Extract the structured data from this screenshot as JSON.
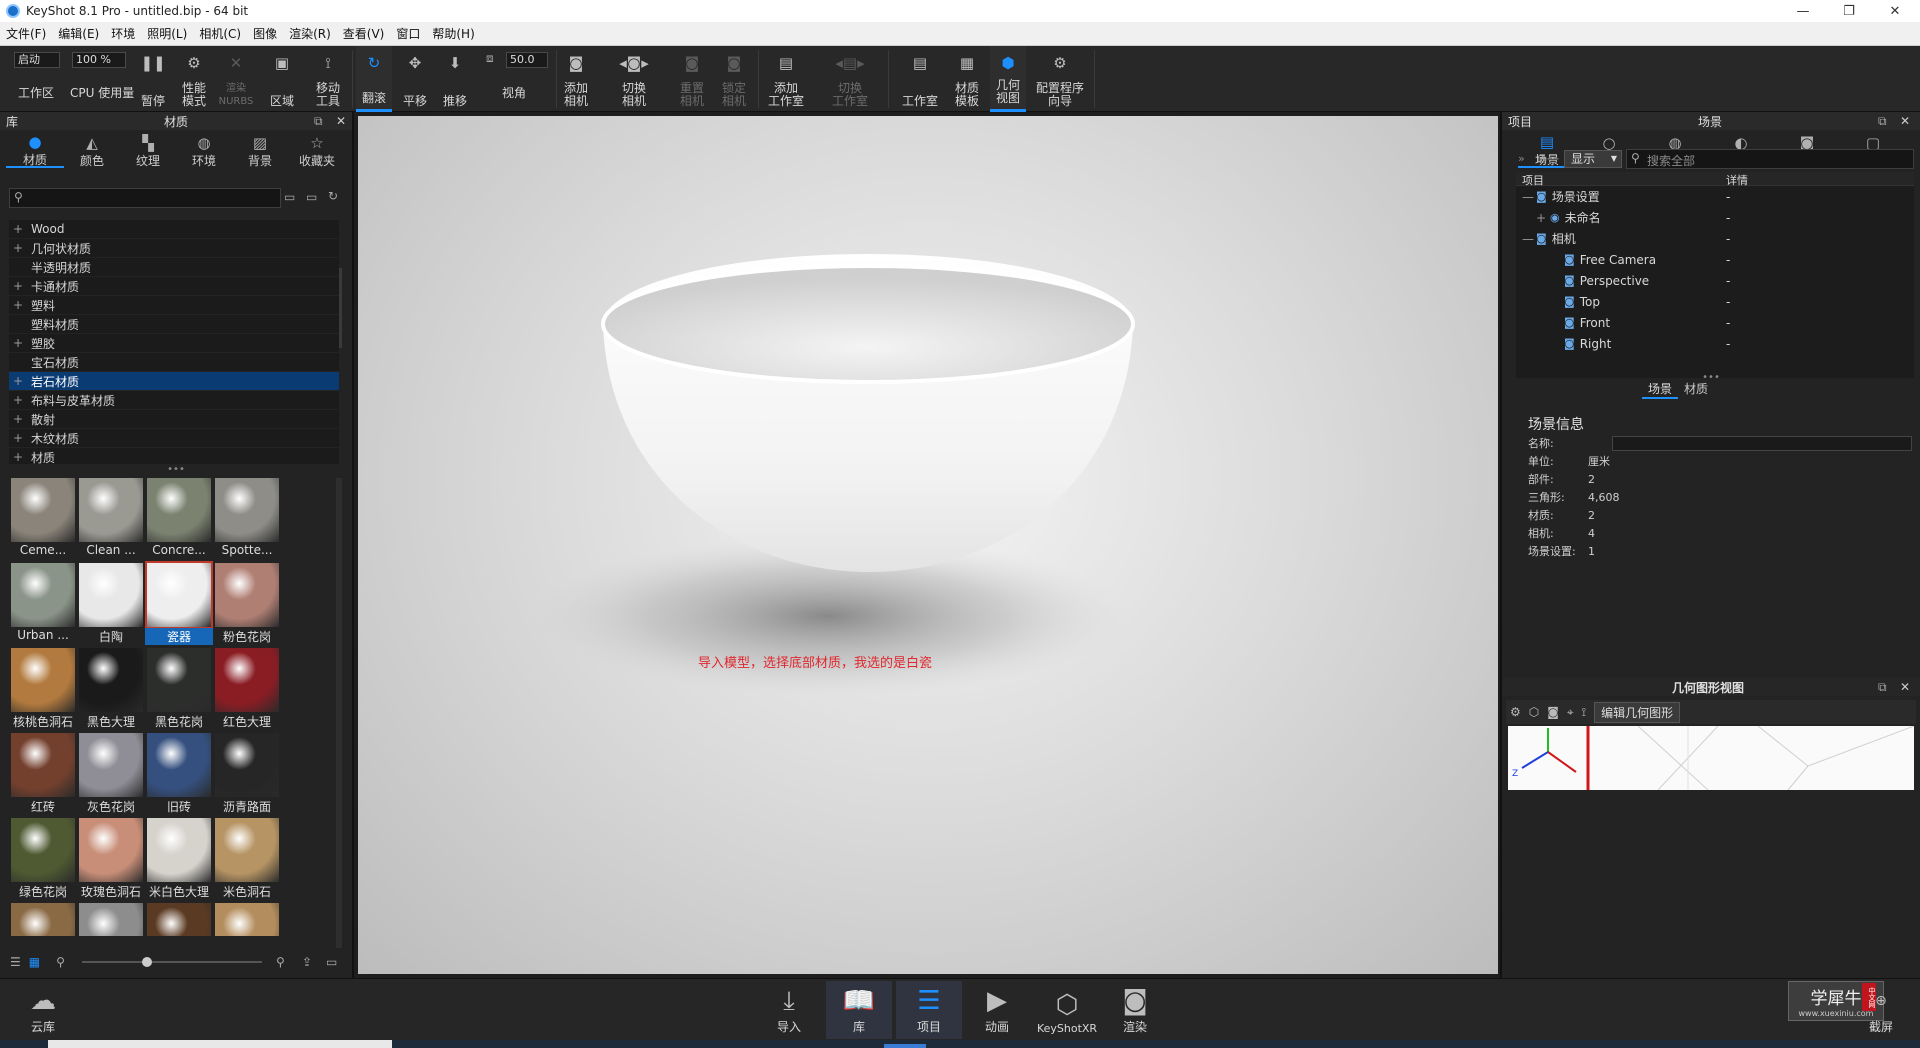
{
  "window": {
    "title": "KeyShot 8.1 Pro  - untitled.bip  - 64 bit",
    "minimize": "—",
    "maximize": "❐",
    "close": "✕"
  },
  "menu": [
    "文件(F)",
    "编辑(E)",
    "环境",
    "照明(L)",
    "相机(C)",
    "图像",
    "渲染(R)",
    "查看(V)",
    "窗口",
    "帮助(H)"
  ],
  "toolbar": {
    "start_value": "启动",
    "percent_value": "100 %",
    "fov_value": "50.0",
    "workspace": "工作区",
    "cpu": "CPU 使用量",
    "pause": "暂停",
    "perf_mode": "性能\n模式",
    "render_nurbs": "渲染\nNURBS",
    "region": "区域",
    "move_tool": "移动\n工具",
    "tumble": "翻滚",
    "pan": "平移",
    "dolly": "推移",
    "view_angle": "视角",
    "add_camera": "添加\n相机",
    "switch_camera": "切换\n相机",
    "reset_camera": "重置\n相机",
    "lock_camera": "锁定\n相机",
    "add_studio": "添加\n工作室",
    "switch_studio": "切换\n工作室",
    "studio": "工作室",
    "material_template": "材质\n模板",
    "geometry_view": "几何\n视图",
    "config_wizard": "配置程序\n向导"
  },
  "library": {
    "panel_label": "库",
    "panel_title": "材质",
    "tabs": [
      "材质",
      "颜色",
      "纹理",
      "环境",
      "背景",
      "收藏夹"
    ],
    "tree": [
      {
        "label": "Wood",
        "expand": "+"
      },
      {
        "label": "几何状材质",
        "expand": "+"
      },
      {
        "label": "半透明材质",
        "expand": ""
      },
      {
        "label": "卡通材质",
        "expand": "+"
      },
      {
        "label": "塑料",
        "expand": "+"
      },
      {
        "label": "塑料材质",
        "expand": ""
      },
      {
        "label": "塑胶",
        "expand": "+"
      },
      {
        "label": "宝石材质",
        "expand": ""
      },
      {
        "label": "岩石材质",
        "expand": "+",
        "selected": true
      },
      {
        "label": "布料与皮革材质",
        "expand": "+"
      },
      {
        "label": "散射",
        "expand": "+"
      },
      {
        "label": "木纹材质",
        "expand": "+"
      },
      {
        "label": "材质",
        "expand": "+"
      }
    ],
    "thumbnails": [
      {
        "label": "Ceme...",
        "color": "#8a847a"
      },
      {
        "label": "Clean ...",
        "color": "#9a9992"
      },
      {
        "label": "Concre...",
        "color": "#7b8270"
      },
      {
        "label": "Spotte...",
        "color": "#8e8d88"
      },
      {
        "label": "Urban ...",
        "color": "#8a9488"
      },
      {
        "label": "白陶",
        "color": "#e8e8e8"
      },
      {
        "label": "瓷器",
        "color": "#eeeeee",
        "selected": true
      },
      {
        "label": "粉色花岗",
        "color": "#b07f74"
      },
      {
        "label": "核桃色洞石",
        "color": "#b27a3e"
      },
      {
        "label": "黑色大理",
        "color": "#1a1a1a"
      },
      {
        "label": "黑色花岗",
        "color": "#2c2e2c"
      },
      {
        "label": "红色大理",
        "color": "#8a1d24"
      },
      {
        "label": "红砖",
        "color": "#74402e"
      },
      {
        "label": "灰色花岗",
        "color": "#8f8d96"
      },
      {
        "label": "旧砖",
        "color": "#35507e"
      },
      {
        "label": "沥青路面",
        "color": "#262626"
      },
      {
        "label": "绿色花岗",
        "color": "#4f5a32"
      },
      {
        "label": "玫瑰色洞石",
        "color": "#c88e78"
      },
      {
        "label": "米白色大理",
        "color": "#d6d2cc"
      },
      {
        "label": "米色洞石",
        "color": "#b69464"
      },
      {
        "label": "",
        "color": "#8a6a45"
      },
      {
        "label": "",
        "color": "#8d8d8d"
      },
      {
        "label": "",
        "color": "#5a3a22"
      },
      {
        "label": "",
        "color": "#b38d5d"
      }
    ]
  },
  "viewport": {
    "annotation": "导入模型，选择底部材质，我选的是白瓷"
  },
  "project": {
    "panel_label": "项目",
    "panel_title": "场景",
    "tabs": [
      "场景",
      "材质",
      "环境",
      "照明",
      "相机",
      "图像"
    ],
    "display_btn": "显示",
    "search_placeholder": "搜索全部",
    "col_item": "项目",
    "col_detail": "详情",
    "rows": [
      {
        "label": "场景设置",
        "detail": "-",
        "indent": 0,
        "expand": "—"
      },
      {
        "label": "未命名",
        "detail": "-",
        "indent": 1,
        "expand": "+"
      },
      {
        "label": "相机",
        "detail": "-",
        "indent": 0,
        "expand": "—"
      },
      {
        "label": "Free Camera",
        "detail": "-",
        "indent": 2,
        "expand": ""
      },
      {
        "label": "Perspective",
        "detail": "-",
        "indent": 2,
        "expand": ""
      },
      {
        "label": "Top",
        "detail": "-",
        "indent": 2,
        "expand": ""
      },
      {
        "label": "Front",
        "detail": "-",
        "indent": 2,
        "expand": ""
      },
      {
        "label": "Right",
        "detail": "-",
        "indent": 2,
        "expand": ""
      }
    ],
    "subtabs": [
      "场景",
      "材质"
    ],
    "info_title": "场景信息",
    "info": [
      {
        "k": "名称:",
        "v": ""
      },
      {
        "k": "单位:",
        "v": "厘米"
      },
      {
        "k": "部件:",
        "v": "2"
      },
      {
        "k": "三角形:",
        "v": "4,608"
      },
      {
        "k": "材质:",
        "v": "2"
      },
      {
        "k": "相机:",
        "v": "4"
      },
      {
        "k": "场景设置:",
        "v": "1"
      }
    ]
  },
  "geometry": {
    "title": "几何图形视图",
    "edit_btn": "编辑几何图形",
    "axis_z": "Z"
  },
  "bottom": {
    "cloud": "云库",
    "import": "导入",
    "library": "库",
    "project": "项目",
    "animation": "动画",
    "keyshotxr": "KeyShotXR",
    "render": "渲染",
    "screenshot": "截屏",
    "watermark": "学犀牛",
    "watermark_url": "www.xuexiniu.com",
    "watermark_badge": "中文网"
  }
}
